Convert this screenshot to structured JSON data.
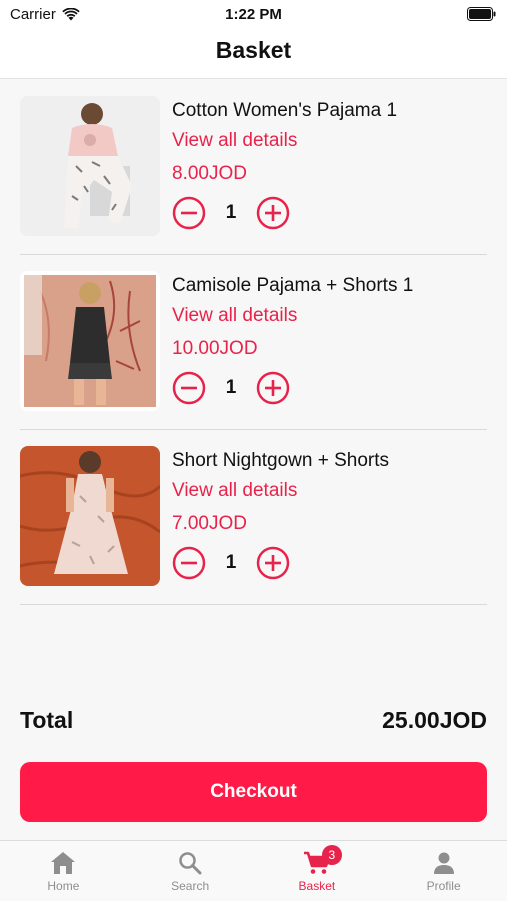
{
  "status_bar": {
    "carrier": "Carrier",
    "time": "1:22 PM"
  },
  "header": {
    "title": "Basket"
  },
  "items": [
    {
      "name": "Cotton Women's Pajama 1",
      "details_link": "View all details",
      "price": "8.00JOD",
      "quantity": "1"
    },
    {
      "name": "Camisole Pajama + Shorts 1",
      "details_link": "View all details",
      "price": "10.00JOD",
      "quantity": "1"
    },
    {
      "name": "Short Nightgown + Shorts",
      "details_link": "View all details",
      "price": "7.00JOD",
      "quantity": "1"
    }
  ],
  "summary": {
    "total_label": "Total",
    "total_value": "25.00JOD"
  },
  "checkout": {
    "label": "Checkout"
  },
  "tabbar": {
    "tabs": [
      {
        "label": "Home",
        "icon": "home-icon"
      },
      {
        "label": "Search",
        "icon": "search-icon"
      },
      {
        "label": "Basket",
        "icon": "cart-icon",
        "badge": "3",
        "active": true
      },
      {
        "label": "Profile",
        "icon": "profile-icon"
      }
    ]
  },
  "colors": {
    "accent": "#e8234b",
    "checkout_bg": "#ff1a47"
  }
}
